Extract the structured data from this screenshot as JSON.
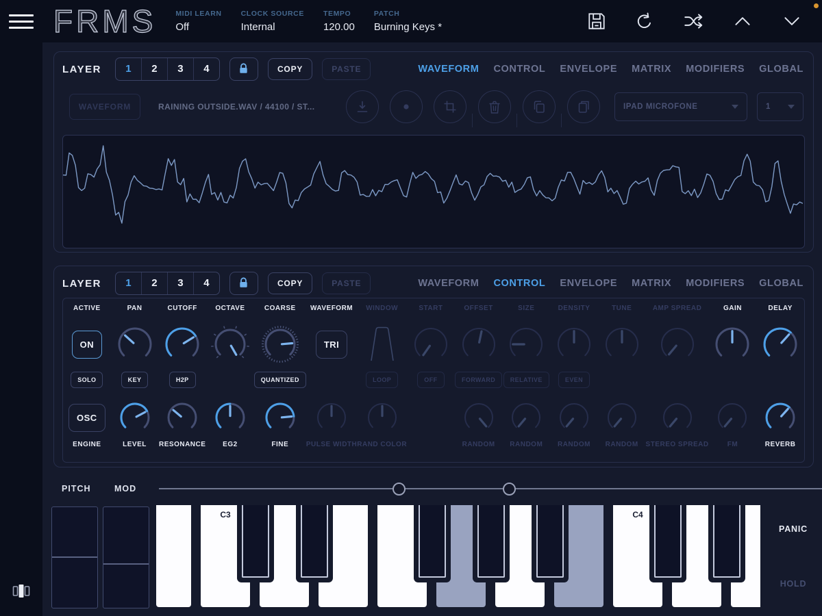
{
  "topbar": {
    "logo": "FRMS",
    "fields": [
      {
        "label": "MIDI LEARN",
        "value": "Off"
      },
      {
        "label": "CLOCK SOURCE",
        "value": "Internal"
      },
      {
        "label": "TEMPO",
        "value": "120.00"
      },
      {
        "label": "PATCH",
        "value": "Burning Keys *"
      }
    ],
    "icons": [
      "save",
      "undo",
      "shuffle",
      "chevron-up",
      "chevron-down"
    ]
  },
  "panels": [
    {
      "label": "LAYER",
      "layer_numbers": [
        "1",
        "2",
        "3",
        "4"
      ],
      "active_layer": "1",
      "locked": true,
      "copy_label": "COPY",
      "paste_label": "PASTE",
      "tabs": [
        "WAVEFORM",
        "CONTROL",
        "ENVELOPE",
        "MATRIX",
        "MODIFIERS",
        "GLOBAL"
      ],
      "active_tab": "WAVEFORM"
    },
    {
      "label": "LAYER",
      "layer_numbers": [
        "1",
        "2",
        "3",
        "4"
      ],
      "active_layer": "1",
      "locked": true,
      "copy_label": "COPY",
      "paste_label": "PASTE",
      "tabs": [
        "WAVEFORM",
        "CONTROL",
        "ENVELOPE",
        "MATRIX",
        "MODIFIERS",
        "GLOBAL"
      ],
      "active_tab": "CONTROL"
    }
  ],
  "sample_toolbar": {
    "waveform_button": "WAVEFORM",
    "file_info": "RAINING OUTSIDE.WAV / 44100 / ST...",
    "icons": [
      "import",
      "record",
      "crop",
      "delete",
      "copy",
      "paste"
    ],
    "input_device": "IPAD MICROFONE",
    "input_channel": "1"
  },
  "controls": {
    "columns": [
      {
        "top_label": "ACTIVE",
        "top_label_on": true,
        "top": {
          "kind": "button",
          "label": "ON",
          "style": "accent"
        },
        "mid": {
          "label": "SOLO",
          "state": "on"
        },
        "bottom": {
          "kind": "button",
          "label": "OSC",
          "style": "normal"
        },
        "bottom_label": "ENGINE",
        "bottom_label_on": true
      },
      {
        "top_label": "PAN",
        "top_label_on": true,
        "top": {
          "kind": "knob",
          "variant": "active",
          "needle": -48
        },
        "mid": {
          "label": "KEY",
          "state": "on"
        },
        "bottom": {
          "kind": "knob",
          "variant": "active",
          "needle": 62,
          "arc": 62
        },
        "bottom_label": "LEVEL",
        "bottom_label_on": true
      },
      {
        "top_label": "CUTOFF",
        "top_label_on": true,
        "top": {
          "kind": "knob",
          "variant": "active",
          "needle": 58,
          "arc": 58
        },
        "mid": {
          "label": "H2P",
          "state": "on"
        },
        "bottom": {
          "kind": "knob",
          "variant": "active",
          "needle": -50
        },
        "bottom_label": "RESONANCE",
        "bottom_label_on": true
      },
      {
        "top_label": "OCTAVE",
        "top_label_on": true,
        "top": {
          "kind": "knob",
          "variant": "active",
          "needle": 150,
          "ticks": "outer"
        },
        "mid": null,
        "bottom": {
          "kind": "knob",
          "variant": "active",
          "needle": 0,
          "arc": 0
        },
        "bottom_label": "EG2",
        "bottom_label_on": true
      },
      {
        "top_label": "COARSE",
        "top_label_on": true,
        "top": {
          "kind": "knob",
          "variant": "active",
          "needle": 85,
          "ticks": "fine"
        },
        "mid": {
          "label": "QUANTIZED",
          "state": "on"
        },
        "bottom": {
          "kind": "knob",
          "variant": "active",
          "needle": 85,
          "arc": 85
        },
        "bottom_label": "FINE",
        "bottom_label_on": true
      },
      {
        "top_label": "WAVEFORM",
        "top_label_on": true,
        "top": {
          "kind": "button",
          "label": "TRI",
          "style": "normal"
        },
        "mid": null,
        "bottom": {
          "kind": "knob",
          "variant": "dim",
          "needle": 0
        },
        "bottom_label": "PULSE WIDTH",
        "bottom_label_on": false
      },
      {
        "top_label": "WINDOW",
        "top_label_on": false,
        "top": {
          "kind": "shape-window"
        },
        "mid": {
          "label": "LOOP",
          "state": "dim"
        },
        "bottom": {
          "kind": "knob",
          "variant": "dim",
          "needle": 0
        },
        "bottom_label": "RAND COLOR",
        "bottom_label_on": false
      },
      {
        "top_label": "START",
        "top_label_on": false,
        "top": {
          "kind": "knob",
          "variant": "dim",
          "needle": -145
        },
        "mid": {
          "label": "OFF",
          "state": "dim"
        },
        "bottom": null,
        "bottom_label": "",
        "bottom_label_on": false
      },
      {
        "top_label": "OFFSET",
        "top_label_on": false,
        "top": {
          "kind": "knob",
          "variant": "dim",
          "needle": 12
        },
        "mid": {
          "label": "FORWARD",
          "state": "dim"
        },
        "bottom": {
          "kind": "knob",
          "variant": "dim",
          "needle": 140
        },
        "bottom_label": "RANDOM",
        "bottom_label_on": false
      },
      {
        "top_label": "SIZE",
        "top_label_on": false,
        "top": {
          "kind": "knob",
          "variant": "dim",
          "needle": -90
        },
        "mid": {
          "label": "RELATIVE",
          "state": "dim"
        },
        "bottom": {
          "kind": "knob",
          "variant": "dim",
          "needle": -140
        },
        "bottom_label": "RANDOM",
        "bottom_label_on": false
      },
      {
        "top_label": "DENSITY",
        "top_label_on": false,
        "top": {
          "kind": "knob",
          "variant": "dim",
          "needle": 0
        },
        "mid": {
          "label": "EVEN",
          "state": "dim"
        },
        "bottom": {
          "kind": "knob",
          "variant": "dim",
          "needle": -140
        },
        "bottom_label": "RANDOM",
        "bottom_label_on": false
      },
      {
        "top_label": "TUNE",
        "top_label_on": false,
        "top": {
          "kind": "knob",
          "variant": "dim",
          "needle": 0
        },
        "mid": null,
        "bottom": {
          "kind": "knob",
          "variant": "dim",
          "needle": -140
        },
        "bottom_label": "RANDOM",
        "bottom_label_on": false
      },
      {
        "top_label": "AMP SPREAD",
        "top_label_on": false,
        "top": {
          "kind": "knob",
          "variant": "dim",
          "needle": -140
        },
        "mid": null,
        "bottom": {
          "kind": "knob",
          "variant": "dim",
          "needle": -140
        },
        "bottom_label": "STEREO SPREAD",
        "bottom_label_on": false
      },
      {
        "top_label": "GAIN",
        "top_label_on": true,
        "top": {
          "kind": "knob",
          "variant": "active",
          "needle": 0
        },
        "mid": null,
        "bottom": {
          "kind": "knob",
          "variant": "dim",
          "needle": -140
        },
        "bottom_label": "FM",
        "bottom_label_on": false
      },
      {
        "top_label": "DELAY",
        "top_label_on": true,
        "top": {
          "kind": "knob",
          "variant": "active",
          "needle": 42,
          "arc": 42
        },
        "mid": null,
        "bottom": {
          "kind": "knob",
          "variant": "active",
          "needle": 42,
          "arc": 42
        },
        "bottom_label": "REVERB",
        "bottom_label_on": true
      }
    ]
  },
  "wheels": {
    "pitch_label": "PITCH",
    "mod_label": "MOD"
  },
  "keyboard": {
    "white_keys": [
      "B2",
      "C3",
      "D3",
      "E3",
      "F3",
      "G3",
      "A3",
      "B3",
      "C4",
      "D4",
      "E4"
    ],
    "black_keys": [
      "C#3",
      "D#3",
      "F#3",
      "G#3",
      "A#3",
      "C#4",
      "D#4"
    ],
    "labels": [
      "C3",
      "C4"
    ],
    "pressed_keys": [
      "G3",
      "B3"
    ]
  },
  "right_controls": {
    "panic": "PANIC",
    "hold": "HOLD"
  },
  "colors": {
    "accent": "#4da0e8",
    "pressed_key": "#99a3c0",
    "waveform": "#7d9ac6",
    "notification": "#d9952f",
    "knob_track": "#454e72",
    "knob_dim": "#262d4b",
    "needle": "#7db4ee"
  }
}
